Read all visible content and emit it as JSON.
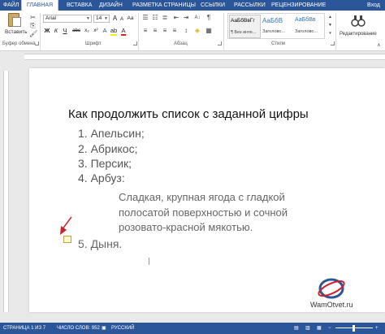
{
  "tabs": {
    "file": "ФАЙЛ",
    "home": "ГЛАВНАЯ",
    "insert": "ВСТАВКА",
    "design": "ДИЗАЙН",
    "layout": "РАЗМЕТКА СТРАНИЦЫ",
    "references": "ССЫЛКИ",
    "mailings": "РАССЫЛКИ",
    "review": "РЕЦЕНЗИРОВАНИЕ",
    "signin": "Вход"
  },
  "ribbon": {
    "paste_label": "Вставить",
    "font_name": "Arial",
    "font_size": "14",
    "bold": "Ж",
    "italic": "К",
    "underline": "Ч",
    "strike": "abc",
    "subscript": "x₂",
    "superscript": "x²",
    "font_color_glyph": "A",
    "grow_font": "A",
    "shrink_font": "A",
    "change_case": "Aa",
    "styles": [
      {
        "preview": "АаБбВвГг",
        "name": "¶ Без инте..."
      },
      {
        "preview": "АаБбВ",
        "name": "Заголово..."
      },
      {
        "preview": "АаБбВв",
        "name": "Заголово..."
      }
    ],
    "editing_label": "Редактирование",
    "groups": {
      "clipboard": "Буфер обмена",
      "font": "Шрифт",
      "paragraph": "Абзац",
      "styles": "Стили"
    }
  },
  "document": {
    "title": "Как продолжить список с заданной цифры",
    "items": [
      "1. Апельсин;",
      "2. Абрикос;",
      "3. Персик;",
      "4. Арбуз:"
    ],
    "paragraph": "Сладкая, крупная ягода с гладкой полосатой поверхностью и сочной розовато-красной мякотью.",
    "item5": "5. Дыня."
  },
  "watermark": "WamOtvet.ru",
  "status": {
    "page": "СТРАНИЦА 1 ИЗ 7",
    "words": "ЧИСЛО СЛОВ: 952",
    "language": "РУССКИЙ"
  },
  "colors": {
    "accent": "#2b579a",
    "arrow": "#c0282d"
  }
}
